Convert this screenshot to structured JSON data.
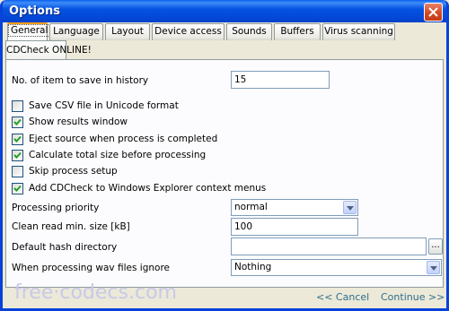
{
  "window": {
    "title": "Options"
  },
  "tabs_row1": [
    {
      "label": "General"
    },
    {
      "label": "Language"
    },
    {
      "label": "Layout"
    },
    {
      "label": "Device access"
    },
    {
      "label": "Sounds"
    },
    {
      "label": "Buffers"
    },
    {
      "label": "Virus scanning"
    }
  ],
  "tabs_row2": [
    {
      "label": "CDCheck ONLINE!"
    }
  ],
  "active_tab": "General",
  "general": {
    "history_label": "No. of item to save in history",
    "history_value": "15",
    "checkboxes": [
      {
        "label": "Save CSV file in Unicode format",
        "checked": false
      },
      {
        "label": "Show results window",
        "checked": true
      },
      {
        "label": "Eject source when process is completed",
        "checked": true
      },
      {
        "label": "Calculate total size before processing",
        "checked": true
      },
      {
        "label": "Skip process setup",
        "checked": false
      },
      {
        "label": "Add CDCheck to Windows Explorer context menus",
        "checked": true
      }
    ],
    "priority_label": "Processing priority",
    "priority_value": "normal",
    "clean_read_label": "Clean read min. size [kB]",
    "clean_read_value": "100",
    "hash_dir_label": "Default hash directory",
    "hash_dir_value": "",
    "browse_label": "...",
    "wav_label": "When processing wav files ignore",
    "wav_value": "Nothing"
  },
  "footer": {
    "watermark": "free·codecs.com",
    "cancel_label": "<< Cancel",
    "continue_label": "Continue >>"
  },
  "colors": {
    "titlebar": "#0553E1",
    "accent": "#FF9D1C",
    "link": "#2E6F8E",
    "watermark": "#C8C9E8"
  }
}
